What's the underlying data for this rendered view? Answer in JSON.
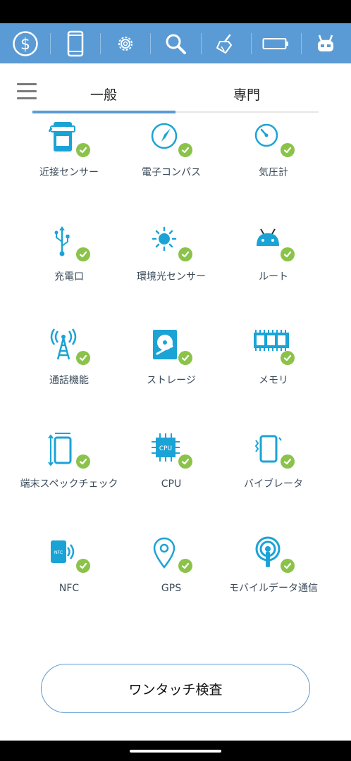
{
  "toolbar": {
    "items": [
      {
        "icon": "dollar-icon"
      },
      {
        "icon": "phone-icon"
      },
      {
        "icon": "gear-icon"
      },
      {
        "icon": "search-icon"
      },
      {
        "icon": "broom-icon"
      },
      {
        "icon": "battery-icon"
      },
      {
        "icon": "mascot-icon"
      }
    ],
    "accent": "#5b9bd5"
  },
  "tabs": [
    {
      "label": "一般",
      "active": true
    },
    {
      "label": "専門",
      "active": false
    }
  ],
  "grid": [
    {
      "label": "近接センサー",
      "icon": "proximity-sensor-icon"
    },
    {
      "label": "電子コンパス",
      "icon": "compass-icon"
    },
    {
      "label": "気圧計",
      "icon": "barometer-icon"
    },
    {
      "label": "充電口",
      "icon": "usb-icon"
    },
    {
      "label": "環境光センサー",
      "icon": "light-sensor-icon"
    },
    {
      "label": "ルート",
      "icon": "android-root-icon"
    },
    {
      "label": "通話機能",
      "icon": "call-tower-icon"
    },
    {
      "label": "ストレージ",
      "icon": "storage-disk-icon"
    },
    {
      "label": "メモリ",
      "icon": "memory-icon"
    },
    {
      "label": "端末スペックチェック",
      "icon": "device-spec-icon"
    },
    {
      "label": "CPU",
      "icon": "cpu-icon"
    },
    {
      "label": "バイブレータ",
      "icon": "vibrator-icon"
    },
    {
      "label": "NFC",
      "icon": "nfc-icon"
    },
    {
      "label": "GPS",
      "icon": "gps-pin-icon"
    },
    {
      "label": "モバイルデータ通信",
      "icon": "mobile-data-icon"
    }
  ],
  "cpu_chip_text": "CPU",
  "nfc_chip_text": "NFC",
  "check_color": "#8bc34a",
  "icon_color": "#1ba3d6",
  "bottom_button": {
    "label": "ワンタッチ検査"
  }
}
